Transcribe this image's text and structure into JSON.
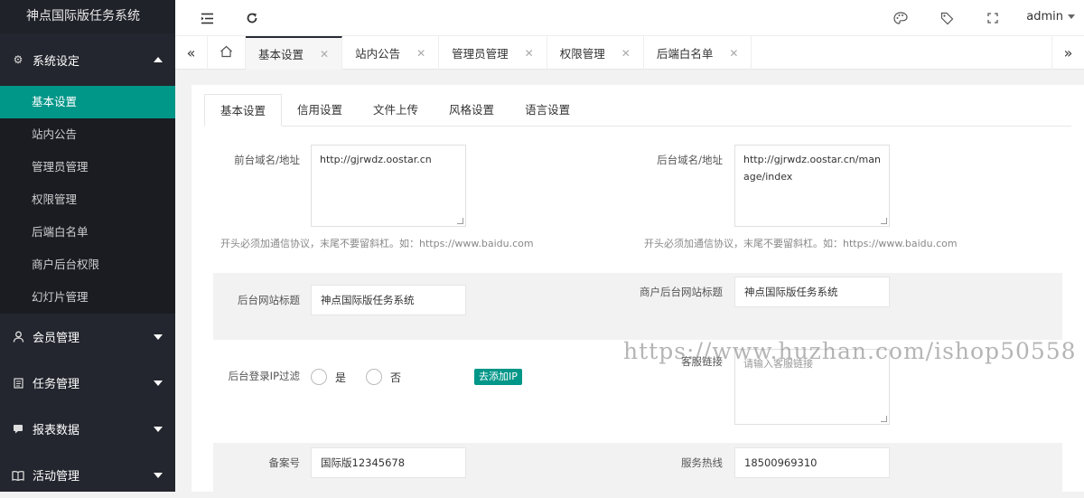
{
  "app": {
    "title": "神点国际版任务系统"
  },
  "sidebar": {
    "groups": [
      {
        "label": "系统设定",
        "icon": "gear-icon",
        "expanded": true,
        "items": [
          "基本设置",
          "站内公告",
          "管理员管理",
          "权限管理",
          "后端白名单",
          "商户后台权限",
          "幻灯片管理"
        ]
      },
      {
        "label": "会员管理",
        "icon": "user-icon"
      },
      {
        "label": "任务管理",
        "icon": "document-icon"
      },
      {
        "label": "报表数据",
        "icon": "chat-icon"
      },
      {
        "label": "活动管理",
        "icon": "book-icon"
      }
    ],
    "active_item": "基本设置"
  },
  "topbar": {
    "user": "admin"
  },
  "tabs": [
    "基本设置",
    "站内公告",
    "管理员管理",
    "权限管理",
    "后端白名单"
  ],
  "card_tabs": [
    "基本设置",
    "信用设置",
    "文件上传",
    "风格设置",
    "语言设置"
  ],
  "form": {
    "front_domain_label": "前台域名/地址",
    "front_domain_value": "http://gjrwdz.oostar.cn",
    "back_domain_label": "后台域名/地址",
    "back_domain_value": "http://gjrwdz.oostar.cn/manage/index",
    "domain_hint": "开头必须加通信协议，末尾不要留斜杠。如：https://www.baidu.com",
    "admin_title_label": "后台网站标题",
    "admin_title_value": "神点国际版任务系统",
    "merchant_title_label": "商户后台网站标题",
    "merchant_title_value": "神点国际版任务系统",
    "ip_filter_label": "后台登录IP过滤",
    "ip_filter_yes": "是",
    "ip_filter_no": "否",
    "add_ip_button": "去添加IP",
    "service_link_label": "客服链接",
    "service_link_placeholder": "请输入客服链接",
    "icp_label": "备案号",
    "icp_value": "国际版12345678",
    "hotline_label": "服务热线",
    "hotline_value": "18500969310"
  },
  "watermark": "https://www.huzhan.com/ishop50558"
}
